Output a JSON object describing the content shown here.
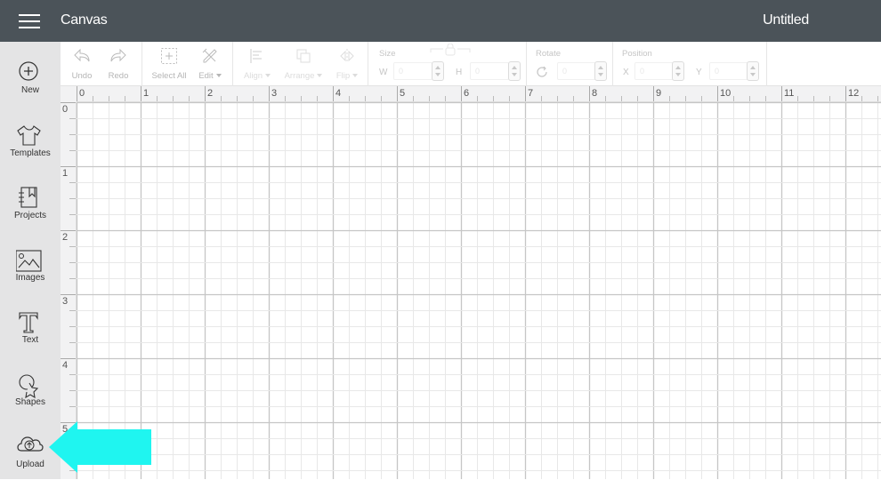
{
  "header": {
    "menu_icon": "hamburger-icon",
    "app_title": "Canvas",
    "document_title": "Untitled"
  },
  "sidebar": {
    "items": [
      {
        "label": "New",
        "icon": "plus-circle-icon"
      },
      {
        "label": "Templates",
        "icon": "tshirt-icon"
      },
      {
        "label": "Projects",
        "icon": "notebook-icon"
      },
      {
        "label": "Images",
        "icon": "image-icon"
      },
      {
        "label": "Text",
        "icon": "text-icon"
      },
      {
        "label": "Shapes",
        "icon": "shapes-icon"
      },
      {
        "label": "Upload",
        "icon": "cloud-upload-icon"
      }
    ]
  },
  "toolbar": {
    "undo": "Undo",
    "redo": "Redo",
    "select_all": "Select All",
    "edit": "Edit",
    "align": "Align",
    "arrange": "Arrange",
    "flip": "Flip",
    "size": {
      "label": "Size",
      "w_label": "W",
      "w_value": "0",
      "h_label": "H",
      "h_value": "0"
    },
    "rotate": {
      "label": "Rotate",
      "value": "0"
    },
    "position": {
      "label": "Position",
      "x_label": "X",
      "x_value": "0",
      "y_label": "Y",
      "y_value": "0"
    }
  },
  "canvas": {
    "units": "inches",
    "ruler_top": [
      "0",
      "1",
      "2",
      "3",
      "4",
      "5",
      "6",
      "7",
      "8",
      "9",
      "10",
      "11",
      "12"
    ],
    "ruler_left": [
      "0",
      "1",
      "2",
      "3",
      "4",
      "5"
    ],
    "subdivisions_per_unit": 4
  },
  "annotation": {
    "type": "arrow",
    "points_to": "Upload",
    "color": "#1ff5f0"
  }
}
